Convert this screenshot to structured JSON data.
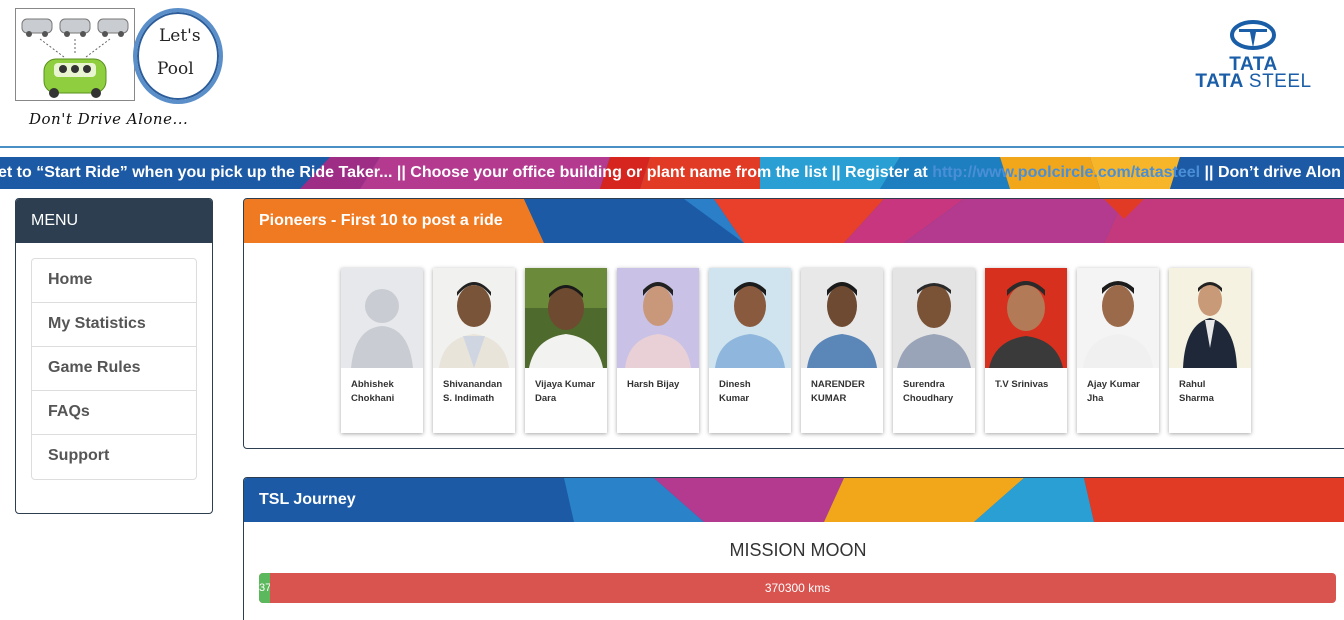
{
  "header": {
    "logo_text_line1": "Let's",
    "logo_text_line2": "Pool",
    "tagline": "Don't Drive Alone...",
    "brand_top": "TATA",
    "brand_bottom_a": "TATA",
    "brand_bottom_b": "STEEL"
  },
  "ticker": {
    "text_before_link": "et to “Start Ride” when you pick up the Ride Taker... || Choose your office building or plant name from the list  || Register at ",
    "link": "http://www.poolcircle.com/tatasteel",
    "text_after_link": " || Don’t drive Alon"
  },
  "menu": {
    "title": "MENU",
    "items": [
      {
        "label": "Home"
      },
      {
        "label": "My Statistics"
      },
      {
        "label": "Game Rules"
      },
      {
        "label": "FAQs"
      },
      {
        "label": "Support"
      }
    ]
  },
  "pioneers": {
    "title": "Pioneers - First 10 to post a ride",
    "people": [
      {
        "name_line1": "Abhishek",
        "name_line2": "Chokhani"
      },
      {
        "name_line1": "Shivanandan",
        "name_line2": "S. Indimath"
      },
      {
        "name_line1": "Vijaya Kumar",
        "name_line2": "Dara"
      },
      {
        "name_line1": "Harsh Bijay",
        "name_line2": ""
      },
      {
        "name_line1": "Dinesh",
        "name_line2": "Kumar"
      },
      {
        "name_line1": "NARENDER",
        "name_line2": "KUMAR"
      },
      {
        "name_line1": "Surendra",
        "name_line2": "Choudhary"
      },
      {
        "name_line1": "T.V Srinivas",
        "name_line2": ""
      },
      {
        "name_line1": "Ajay Kumar",
        "name_line2": "Jha"
      },
      {
        "name_line1": "Rahul",
        "name_line2": "Sharma"
      }
    ]
  },
  "journey": {
    "title": "TSL Journey",
    "mission": "MISSION MOON",
    "progress_done_label": "37",
    "progress_done_fraction": 0.01,
    "progress_remaining_label": "370300 kms"
  }
}
